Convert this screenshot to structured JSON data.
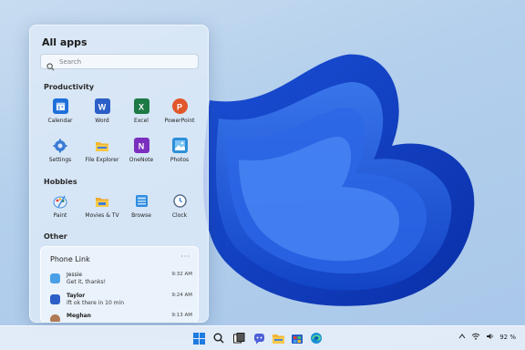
{
  "start_menu": {
    "title": "All apps",
    "search": {
      "placeholder": "Search"
    },
    "sections": {
      "productivity": "Productivity",
      "hobbies": "Hobbies",
      "other": "Other"
    },
    "productivity_apps": [
      {
        "label": "Calendar",
        "icon": "calendar-icon",
        "color": "#1e6fd9"
      },
      {
        "label": "Word",
        "icon": "word-icon",
        "color": "#2b5fc7"
      },
      {
        "label": "Excel",
        "icon": "excel-icon",
        "color": "#1d7a45"
      },
      {
        "label": "PowerPoint",
        "icon": "powerpoint-icon",
        "color": "#e0572a"
      },
      {
        "label": "Settings",
        "icon": "gear-icon",
        "color": "#3a7bd5"
      },
      {
        "label": "File Explorer",
        "icon": "folder-icon",
        "color": "#f2b632"
      },
      {
        "label": "OneNote",
        "icon": "onenote-icon",
        "color": "#7b2fbf"
      },
      {
        "label": "Photos",
        "icon": "photos-icon",
        "color": "#2d8fd8"
      }
    ],
    "hobby_apps": [
      {
        "label": "Paint",
        "icon": "paint-icon",
        "color": "#3d8fe0"
      },
      {
        "label": "Movies & TV",
        "icon": "movies-icon",
        "color": "#f0a930"
      },
      {
        "label": "Browse",
        "icon": "browse-icon",
        "color": "#2f8be0"
      },
      {
        "label": "Clock",
        "icon": "clock-icon",
        "color": "#5a6f8a"
      }
    ],
    "phone_link": {
      "title": "Phone Link",
      "more": "···",
      "messages": [
        {
          "name": "Jessie",
          "text": "Get it, thanks!",
          "time": "9:32 AM"
        },
        {
          "name": "Taylor",
          "text": "ift ok there in 10 min",
          "time": "9:24 AM"
        },
        {
          "name": "Meghan",
          "text": "",
          "time": "9:13 AM"
        }
      ]
    }
  },
  "taskbar": {
    "icons": [
      "windows-start-icon",
      "search-icon",
      "task-view-icon",
      "chat-icon",
      "file-explorer-icon",
      "store-icon",
      "mail-icon",
      "edge-icon"
    ],
    "tray": {
      "battery": "92 %"
    }
  }
}
